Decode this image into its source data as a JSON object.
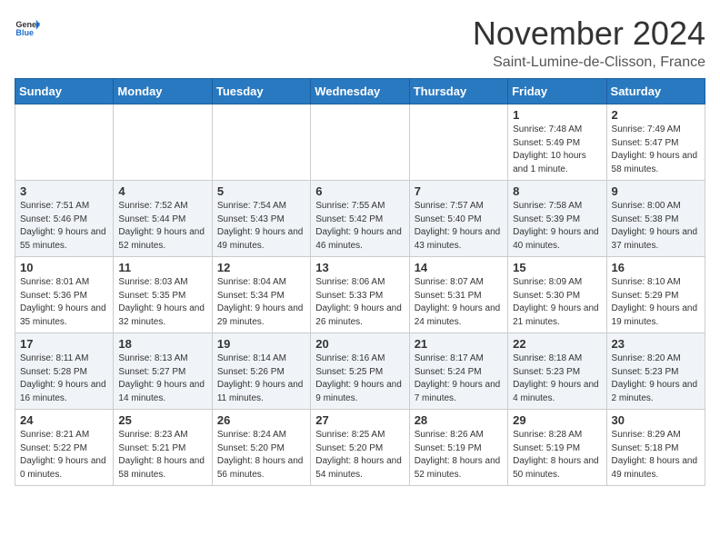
{
  "header": {
    "logo": {
      "general": "General",
      "blue": "Blue"
    },
    "month": "November 2024",
    "location": "Saint-Lumine-de-Clisson, France"
  },
  "weekdays": [
    "Sunday",
    "Monday",
    "Tuesday",
    "Wednesday",
    "Thursday",
    "Friday",
    "Saturday"
  ],
  "weeks": [
    [
      {
        "day": "",
        "info": ""
      },
      {
        "day": "",
        "info": ""
      },
      {
        "day": "",
        "info": ""
      },
      {
        "day": "",
        "info": ""
      },
      {
        "day": "",
        "info": ""
      },
      {
        "day": "1",
        "info": "Sunrise: 7:48 AM\nSunset: 5:49 PM\nDaylight: 10 hours and 1 minute."
      },
      {
        "day": "2",
        "info": "Sunrise: 7:49 AM\nSunset: 5:47 PM\nDaylight: 9 hours and 58 minutes."
      }
    ],
    [
      {
        "day": "3",
        "info": "Sunrise: 7:51 AM\nSunset: 5:46 PM\nDaylight: 9 hours and 55 minutes."
      },
      {
        "day": "4",
        "info": "Sunrise: 7:52 AM\nSunset: 5:44 PM\nDaylight: 9 hours and 52 minutes."
      },
      {
        "day": "5",
        "info": "Sunrise: 7:54 AM\nSunset: 5:43 PM\nDaylight: 9 hours and 49 minutes."
      },
      {
        "day": "6",
        "info": "Sunrise: 7:55 AM\nSunset: 5:42 PM\nDaylight: 9 hours and 46 minutes."
      },
      {
        "day": "7",
        "info": "Sunrise: 7:57 AM\nSunset: 5:40 PM\nDaylight: 9 hours and 43 minutes."
      },
      {
        "day": "8",
        "info": "Sunrise: 7:58 AM\nSunset: 5:39 PM\nDaylight: 9 hours and 40 minutes."
      },
      {
        "day": "9",
        "info": "Sunrise: 8:00 AM\nSunset: 5:38 PM\nDaylight: 9 hours and 37 minutes."
      }
    ],
    [
      {
        "day": "10",
        "info": "Sunrise: 8:01 AM\nSunset: 5:36 PM\nDaylight: 9 hours and 35 minutes."
      },
      {
        "day": "11",
        "info": "Sunrise: 8:03 AM\nSunset: 5:35 PM\nDaylight: 9 hours and 32 minutes."
      },
      {
        "day": "12",
        "info": "Sunrise: 8:04 AM\nSunset: 5:34 PM\nDaylight: 9 hours and 29 minutes."
      },
      {
        "day": "13",
        "info": "Sunrise: 8:06 AM\nSunset: 5:33 PM\nDaylight: 9 hours and 26 minutes."
      },
      {
        "day": "14",
        "info": "Sunrise: 8:07 AM\nSunset: 5:31 PM\nDaylight: 9 hours and 24 minutes."
      },
      {
        "day": "15",
        "info": "Sunrise: 8:09 AM\nSunset: 5:30 PM\nDaylight: 9 hours and 21 minutes."
      },
      {
        "day": "16",
        "info": "Sunrise: 8:10 AM\nSunset: 5:29 PM\nDaylight: 9 hours and 19 minutes."
      }
    ],
    [
      {
        "day": "17",
        "info": "Sunrise: 8:11 AM\nSunset: 5:28 PM\nDaylight: 9 hours and 16 minutes."
      },
      {
        "day": "18",
        "info": "Sunrise: 8:13 AM\nSunset: 5:27 PM\nDaylight: 9 hours and 14 minutes."
      },
      {
        "day": "19",
        "info": "Sunrise: 8:14 AM\nSunset: 5:26 PM\nDaylight: 9 hours and 11 minutes."
      },
      {
        "day": "20",
        "info": "Sunrise: 8:16 AM\nSunset: 5:25 PM\nDaylight: 9 hours and 9 minutes."
      },
      {
        "day": "21",
        "info": "Sunrise: 8:17 AM\nSunset: 5:24 PM\nDaylight: 9 hours and 7 minutes."
      },
      {
        "day": "22",
        "info": "Sunrise: 8:18 AM\nSunset: 5:23 PM\nDaylight: 9 hours and 4 minutes."
      },
      {
        "day": "23",
        "info": "Sunrise: 8:20 AM\nSunset: 5:23 PM\nDaylight: 9 hours and 2 minutes."
      }
    ],
    [
      {
        "day": "24",
        "info": "Sunrise: 8:21 AM\nSunset: 5:22 PM\nDaylight: 9 hours and 0 minutes."
      },
      {
        "day": "25",
        "info": "Sunrise: 8:23 AM\nSunset: 5:21 PM\nDaylight: 8 hours and 58 minutes."
      },
      {
        "day": "26",
        "info": "Sunrise: 8:24 AM\nSunset: 5:20 PM\nDaylight: 8 hours and 56 minutes."
      },
      {
        "day": "27",
        "info": "Sunrise: 8:25 AM\nSunset: 5:20 PM\nDaylight: 8 hours and 54 minutes."
      },
      {
        "day": "28",
        "info": "Sunrise: 8:26 AM\nSunset: 5:19 PM\nDaylight: 8 hours and 52 minutes."
      },
      {
        "day": "29",
        "info": "Sunrise: 8:28 AM\nSunset: 5:19 PM\nDaylight: 8 hours and 50 minutes."
      },
      {
        "day": "30",
        "info": "Sunrise: 8:29 AM\nSunset: 5:18 PM\nDaylight: 8 hours and 49 minutes."
      }
    ]
  ]
}
